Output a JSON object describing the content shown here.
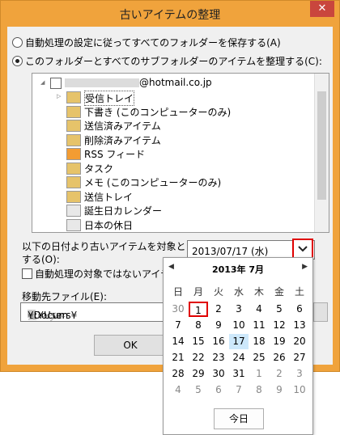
{
  "window": {
    "title": "古いアイテムの整理",
    "close_glyph": "✕"
  },
  "options": {
    "radio_auto": "自動処理の設定に従ってすべてのフォルダーを保存する(A)",
    "radio_this": "このフォルダーとすべてのサブフォルダーのアイテムを整理する(C):"
  },
  "tree": {
    "account": "@hotmail.co.jp",
    "items": [
      {
        "label": "受信トレイ",
        "icon": "inbox-icon"
      },
      {
        "label": "下書き (このコンピューターのみ)",
        "icon": "drafts-icon"
      },
      {
        "label": "送信済みアイテム",
        "icon": "sent-icon"
      },
      {
        "label": "削除済みアイテム",
        "icon": "trash-icon"
      },
      {
        "label": "RSS フィード",
        "icon": "rss-icon"
      },
      {
        "label": "タスク",
        "icon": "task-icon"
      },
      {
        "label": "メモ (このコンピューターのみ)",
        "icon": "note-icon"
      },
      {
        "label": "送信トレイ",
        "icon": "outbox-icon"
      },
      {
        "label": "誕生日カレンダー",
        "icon": "calendar-icon"
      },
      {
        "label": "日本の休日",
        "icon": "calendar-icon"
      }
    ]
  },
  "date_section": {
    "label_line1": "以下の日付より古いアイテムを対象と",
    "label_line2": "する(O):",
    "value": "2013/07/17 (水)",
    "exclude_checkbox": "自動処理の対象ではないアイテムを"
  },
  "move": {
    "label": "移動先ファイル(E):",
    "path_start": "C:¥Users¥",
    "path_mid": "ユーザー",
    "path_end": "¥Docum"
  },
  "buttons": {
    "ok": "OK"
  },
  "calendar": {
    "month_title": "2013年 7月",
    "prev": "◀",
    "next": "▶",
    "weekdays": [
      "日",
      "月",
      "火",
      "水",
      "木",
      "金",
      "土"
    ],
    "weeks": [
      [
        "30",
        "1",
        "2",
        "3",
        "4",
        "5",
        "6"
      ],
      [
        "7",
        "8",
        "9",
        "10",
        "11",
        "12",
        "13"
      ],
      [
        "14",
        "15",
        "16",
        "17",
        "18",
        "19",
        "20"
      ],
      [
        "21",
        "22",
        "23",
        "24",
        "25",
        "26",
        "27"
      ],
      [
        "28",
        "29",
        "30",
        "31",
        "1",
        "2",
        "3"
      ],
      [
        "4",
        "5",
        "6",
        "7",
        "8",
        "9",
        "10"
      ]
    ],
    "today_button": "今日",
    "today_value": "17",
    "selected_value": "1"
  }
}
